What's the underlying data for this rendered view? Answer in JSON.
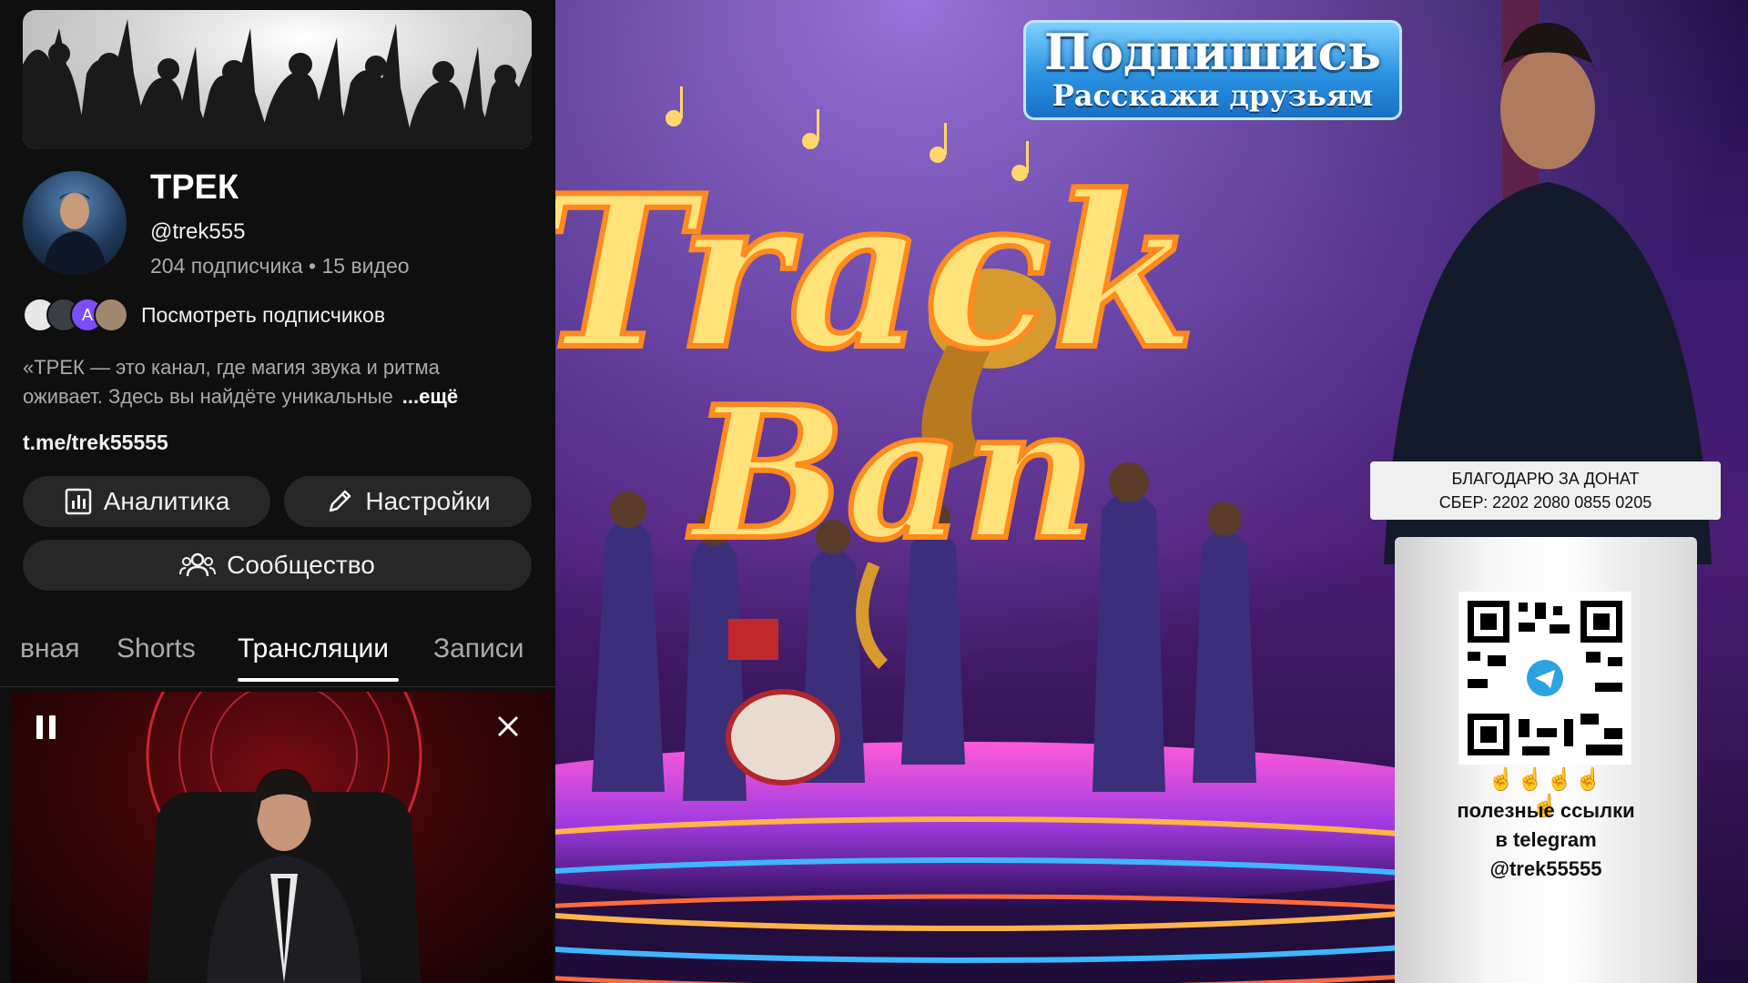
{
  "channel": {
    "name": "ТРЕК",
    "handle": "@trek555",
    "stats": "204 подписчика • 15 видео",
    "view_subscribers": "Посмотреть подписчиков",
    "mini_avatar_letter": "A",
    "description_line1": "«ТРЕК — это канал, где магия звука и ритма",
    "description_line2": "оживает. Здесь вы найдёте уникальные",
    "more_label": "...ещё",
    "link": "t.me/trek55555"
  },
  "actions": {
    "analytics_label": "Аналитика",
    "settings_label": "Настройки",
    "community_label": "Сообщество"
  },
  "tabs": [
    {
      "label": "вная",
      "active": false
    },
    {
      "label": "Shorts",
      "active": false
    },
    {
      "label": "Трансляции",
      "active": true
    },
    {
      "label": "Записи",
      "active": false
    }
  ],
  "video": {
    "subscribe_title": "Подпишись",
    "subscribe_subtitle": "Расскажи друзьям",
    "logo_text_line1": "Track",
    "logo_text_line2": "Ban",
    "donate_line1": "БЛАГОДАРЮ ЗА ДОНАТ",
    "donate_line2": "СБЕР: 2202 2080 0855 0205",
    "emoji_row": "☝☝☝☝☝",
    "podium_line1": "полезные ссылки",
    "podium_line2": "в telegram",
    "podium_line3": "@trek55555"
  },
  "colors": {
    "background": "#0f0f0f",
    "button_bg": "#272727",
    "muted_text": "#aaaaaa",
    "subscribe_blue": "#2b93e2",
    "neon_yellow": "#ffe27a"
  },
  "icons": {
    "analytics": "bar-chart-icon",
    "settings": "pencil-icon",
    "community": "people-icon",
    "pause": "pause-icon",
    "close": "close-icon",
    "telegram": "telegram-icon"
  }
}
